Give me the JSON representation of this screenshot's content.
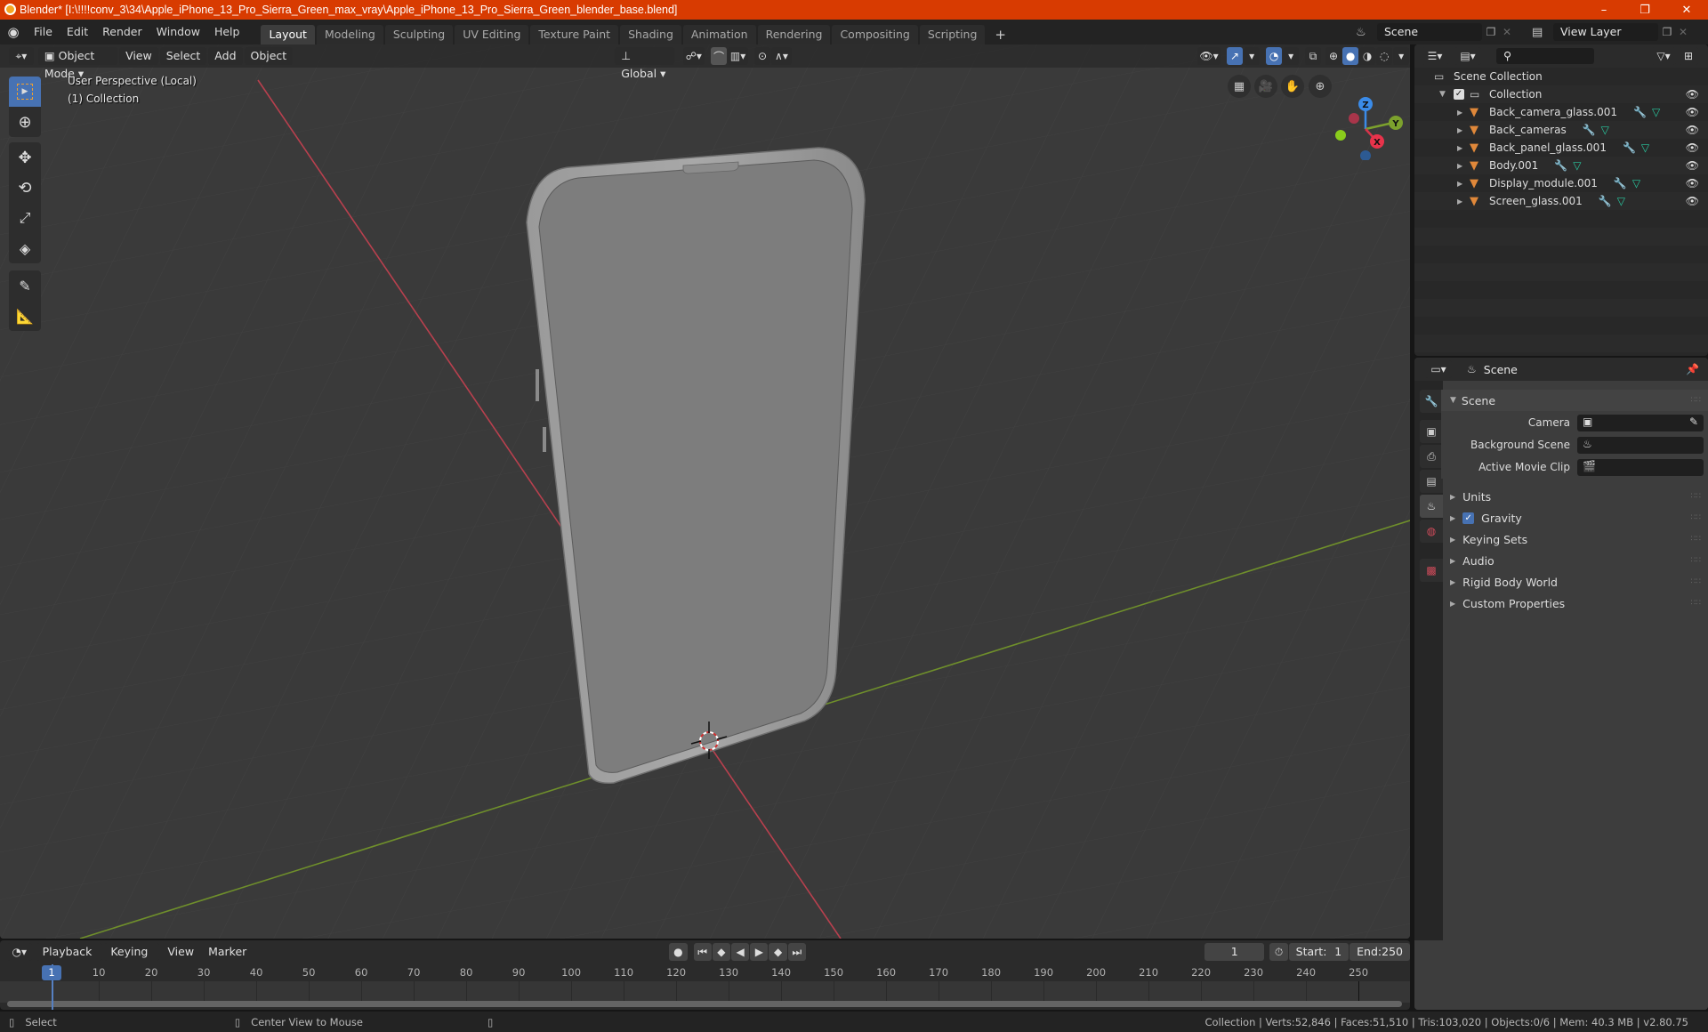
{
  "window": {
    "title": "Blender* [I:\\!!!!conv_3\\34\\Apple_iPhone_13_Pro_Sierra_Green_max_vray\\Apple_iPhone_13_Pro_Sierra_Green_blender_base.blend]",
    "controls": {
      "minimize": "–",
      "maximize": "❐",
      "close": "✕"
    }
  },
  "menubar": {
    "items": [
      "File",
      "Edit",
      "Render",
      "Window",
      "Help"
    ],
    "workspaces": [
      "Layout",
      "Modeling",
      "Sculpting",
      "UV Editing",
      "Texture Paint",
      "Shading",
      "Animation",
      "Rendering",
      "Compositing",
      "Scripting"
    ],
    "active_workspace": "Layout",
    "add_workspace": "+",
    "scene_field": "Scene",
    "view_layer_field": "View Layer"
  },
  "viewport": {
    "mode": "Object Mode",
    "menus": [
      "View",
      "Select",
      "Add",
      "Object"
    ],
    "transform_orientation": "Global",
    "overlay_line1": "User Perspective (Local)",
    "overlay_line2": "(1) Collection",
    "gizmo_axes": {
      "z": "Z",
      "y": "Y",
      "x": "X"
    },
    "colors": {
      "x_axis": "#d8344a",
      "y_axis": "#7ca12d",
      "z_axis": "#3a8be8",
      "accent": "#4772b3"
    }
  },
  "outliner": {
    "search_placeholder": "",
    "root": "Scene Collection",
    "collection": "Collection",
    "objects": [
      {
        "name": "Back_camera_glass.001"
      },
      {
        "name": "Back_cameras"
      },
      {
        "name": "Back_panel_glass.001"
      },
      {
        "name": "Body.001"
      },
      {
        "name": "Display_module.001"
      },
      {
        "name": "Screen_glass.001"
      }
    ]
  },
  "properties": {
    "header_title": "Scene",
    "panel_title": "Scene",
    "fields": [
      {
        "label": "Camera",
        "value": ""
      },
      {
        "label": "Background Scene",
        "value": ""
      },
      {
        "label": "Active Movie Clip",
        "value": ""
      }
    ],
    "subpanels": [
      "Units",
      "Gravity",
      "Keying Sets",
      "Audio",
      "Rigid Body World",
      "Custom Properties"
    ],
    "gravity_enabled": true
  },
  "timeline": {
    "menus": [
      "Playback",
      "Keying",
      "View",
      "Marker"
    ],
    "current_frame": "1",
    "start_label": "Start:",
    "start": "1",
    "end_label": "End:",
    "end": "250",
    "ruler": [
      "10",
      "20",
      "30",
      "40",
      "50",
      "60",
      "70",
      "80",
      "90",
      "100",
      "110",
      "120",
      "130",
      "140",
      "150",
      "160",
      "170",
      "180",
      "190",
      "200",
      "210",
      "220",
      "230",
      "240",
      "250"
    ],
    "playhead_label": "1"
  },
  "status": {
    "left_action": "Select",
    "middle_action": "Center View to Mouse",
    "stats": "Collection | Verts:52,846 | Faces:51,510 | Tris:103,020 | Objects:0/6 | Mem: 40.3 MB | v2.80.75"
  }
}
